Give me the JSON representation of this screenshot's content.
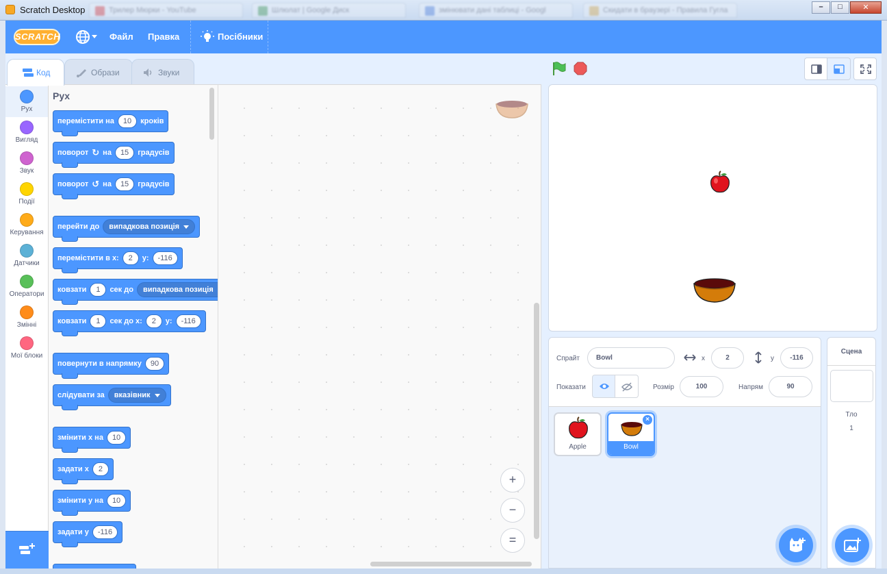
{
  "window": {
    "title": "Scratch Desktop",
    "background_tabs": [
      "Трилер Мюрки - YouTube",
      "Шлюлат | Google Диск",
      "змінювати дані таблиці - Googl",
      "Cкидати в браузері - Правила Гугла"
    ],
    "controls": {
      "minimize": "–",
      "maximize": "□",
      "close": "✕"
    }
  },
  "menubar": {
    "logo_text": "SCRATCH",
    "file": "Файл",
    "edit": "Правка",
    "tutorials": "Посібники"
  },
  "tabs": {
    "code": "Код",
    "costumes": "Образи",
    "sounds": "Звуки"
  },
  "categories": [
    {
      "label": "Рух",
      "color": "#4c97ff"
    },
    {
      "label": "Вигляд",
      "color": "#9966ff"
    },
    {
      "label": "Звук",
      "color": "#cf63cf"
    },
    {
      "label": "Події",
      "color": "#ffd500"
    },
    {
      "label": "Керування",
      "color": "#ffab19"
    },
    {
      "label": "Датчики",
      "color": "#5cb1d6"
    },
    {
      "label": "Оператори",
      "color": "#59c059"
    },
    {
      "label": "Змінні",
      "color": "#ff8c1a"
    },
    {
      "label": "Мої блоки",
      "color": "#ff6680"
    }
  ],
  "flyout": {
    "title": "Рух",
    "blocks": {
      "move": {
        "text": "перемістити на",
        "value": "10",
        "suffix": "кроків"
      },
      "turn_right": {
        "text": "поворот",
        "on": "на",
        "value": "15",
        "suffix": "градусів"
      },
      "turn_left": {
        "text": "поворот",
        "on": "на",
        "value": "15",
        "suffix": "градусів"
      },
      "goto": {
        "text": "перейти до",
        "dropdown": "випадкова позиція"
      },
      "goto_xy": {
        "text": "перемістити в x:",
        "x": "2",
        "ylabel": "y:",
        "y": "-116"
      },
      "glide_to": {
        "text": "ковзати",
        "secs": "1",
        "mid": "сек до",
        "dropdown": "випадкова позиція"
      },
      "glide_xy": {
        "text": "ковзати",
        "secs": "1",
        "mid": "сек до x:",
        "x": "2",
        "ylabel": "y:",
        "y": "-116"
      },
      "point_dir": {
        "text": "повернути в напрямку",
        "value": "90"
      },
      "point_towards": {
        "text": "слідувати за",
        "dropdown": "вказівник"
      },
      "change_x": {
        "text": "змінити x на",
        "value": "10"
      },
      "set_x": {
        "text": "задати x",
        "value": "2"
      },
      "change_y": {
        "text": "змінити y на",
        "value": "10"
      },
      "set_y": {
        "text": "задати y",
        "value": "-116"
      }
    }
  },
  "workspace": {
    "zoom_in": "+",
    "zoom_out": "−",
    "zoom_reset": "="
  },
  "sprite_info": {
    "sprite_label": "Спрайт",
    "sprite_name": "Bowl",
    "x_label": "x",
    "x": "2",
    "y_label": "y",
    "y": "-116",
    "show_label": "Показати",
    "size_label": "Розмір",
    "size": "100",
    "direction_label": "Напрям",
    "direction": "90"
  },
  "sprites": [
    {
      "name": "Apple",
      "selected": false
    },
    {
      "name": "Bowl",
      "selected": true
    }
  ],
  "stage_pane": {
    "title": "Сцена",
    "backdrops_label": "Тло",
    "backdrops_count": "1"
  },
  "colors": {
    "menubar": "#4c97ff",
    "motion": "#4c97ff",
    "apple_red": "#e0141e",
    "bowl_orange": "#d47c0a",
    "bowl_rim": "#5a0a0a"
  }
}
